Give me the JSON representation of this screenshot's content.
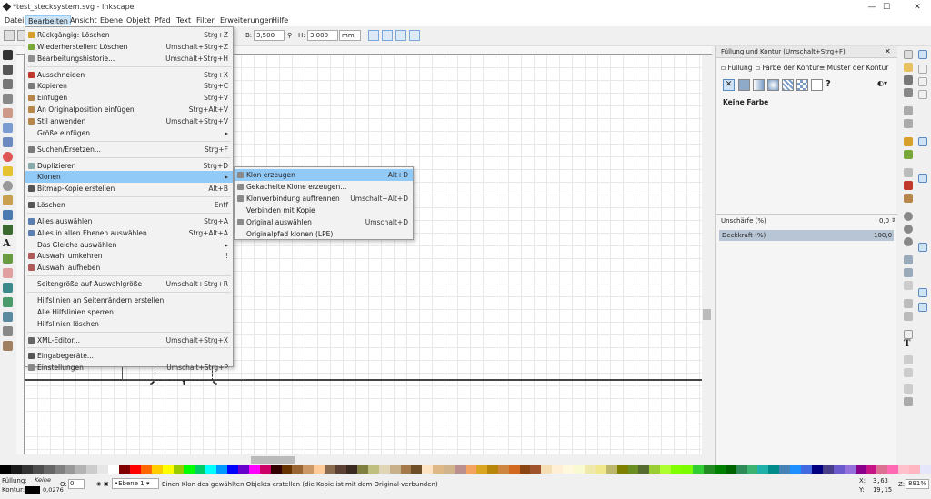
{
  "window": {
    "title": "*test_stecksystem.svg - Inkscape",
    "minimize": "—",
    "maximize": "☐",
    "close": "✕"
  },
  "menubar": [
    "Datei",
    "Bearbeiten",
    "Ansicht",
    "Ebene",
    "Objekt",
    "Pfad",
    "Text",
    "Filter",
    "Erweiterungen",
    "Hilfe"
  ],
  "toolbar": {
    "b_label": "B:",
    "b_value": "3,500",
    "h_label": "H:",
    "h_value": "3,000",
    "unit": "mm"
  },
  "edit_menu": [
    {
      "label": "Rückgängig: Löschen",
      "acc": "Strg+Z",
      "icon": "undo-icon",
      "color": "#d6a02a"
    },
    {
      "label": "Wiederherstellen: Löschen",
      "acc": "Umschalt+Strg+Z",
      "icon": "redo-icon",
      "color": "#7aa83a"
    },
    {
      "label": "Bearbeitungshistorie...",
      "acc": "Umschalt+Strg+H",
      "icon": "history-icon",
      "color": "#8e8e8e"
    },
    {
      "sep": true
    },
    {
      "label": "Ausschneiden",
      "acc": "Strg+X",
      "icon": "cut-icon",
      "color": "#c0392b"
    },
    {
      "label": "Kopieren",
      "acc": "Strg+C",
      "icon": "copy-icon",
      "color": "#7a7a7a"
    },
    {
      "label": "Einfügen",
      "acc": "Strg+V",
      "icon": "paste-icon",
      "color": "#b9864a"
    },
    {
      "label": "An Originalposition einfügen",
      "acc": "Strg+Alt+V",
      "icon": "paste-in-place-icon",
      "color": "#b9864a"
    },
    {
      "label": "Stil anwenden",
      "acc": "Umschalt+Strg+V",
      "icon": "paste-style-icon",
      "color": "#b9864a"
    },
    {
      "label": "Größe einfügen",
      "acc": "▸",
      "icon": "",
      "color": ""
    },
    {
      "sep": true
    },
    {
      "label": "Suchen/Ersetzen...",
      "acc": "Strg+F",
      "icon": "search-icon",
      "color": "#7a7a7a"
    },
    {
      "sep": true
    },
    {
      "label": "Duplizieren",
      "acc": "Strg+D",
      "icon": "duplicate-icon",
      "color": "#8aa"
    },
    {
      "label": "Klonen",
      "acc": "▸",
      "icon": "",
      "color": "",
      "highlight": true
    },
    {
      "label": "Bitmap-Kopie erstellen",
      "acc": "Alt+B",
      "icon": "bitmap-icon",
      "color": "#555"
    },
    {
      "sep": true
    },
    {
      "label": "Löschen",
      "acc": "Entf",
      "icon": "delete-icon",
      "color": "#555"
    },
    {
      "sep": true
    },
    {
      "label": "Alles auswählen",
      "acc": "Strg+A",
      "icon": "select-all-icon",
      "color": "#5a7fb0"
    },
    {
      "label": "Alles in allen Ebenen auswählen",
      "acc": "Strg+Alt+A",
      "icon": "select-all-layers-icon",
      "color": "#5a7fb0"
    },
    {
      "label": "Das Gleiche auswählen",
      "acc": "▸",
      "icon": "",
      "color": ""
    },
    {
      "label": "Auswahl umkehren",
      "acc": "!",
      "icon": "invert-icon",
      "color": "#b05a5a"
    },
    {
      "label": "Auswahl aufheben",
      "acc": "",
      "icon": "deselect-icon",
      "color": "#b05a5a"
    },
    {
      "sep": true
    },
    {
      "label": "Seitengröße auf Auswahlgröße",
      "acc": "Umschalt+Strg+R",
      "icon": "",
      "color": ""
    },
    {
      "sep": true
    },
    {
      "label": "Hilfslinien an Seitenrändern erstellen",
      "acc": "",
      "icon": "",
      "color": ""
    },
    {
      "label": "Alle Hilfslinien sperren",
      "acc": "",
      "icon": "",
      "color": ""
    },
    {
      "label": "Hilfslinien löschen",
      "acc": "",
      "icon": "",
      "color": ""
    },
    {
      "sep": true
    },
    {
      "label": "XML-Editor...",
      "acc": "Umschalt+Strg+X",
      "icon": "xml-icon",
      "color": "#666"
    },
    {
      "sep": true
    },
    {
      "label": "Eingabegeräte...",
      "acc": "",
      "icon": "input-devices-icon",
      "color": "#555"
    },
    {
      "label": "Einstellungen",
      "acc": "Umschalt+Strg+P",
      "icon": "preferences-icon",
      "color": "#888"
    }
  ],
  "clone_submenu": [
    {
      "label": "Klon erzeugen",
      "acc": "Alt+D",
      "highlight": true,
      "icon": "clone-icon"
    },
    {
      "label": "Gekachelte Klone erzeugen...",
      "acc": "",
      "icon": "tiled-clones-icon"
    },
    {
      "label": "Klonverbindung auftrennen",
      "acc": "Umschalt+Alt+D",
      "icon": "unlink-clone-icon"
    },
    {
      "label": "Verbinden mit Kopie",
      "acc": "",
      "icon": ""
    },
    {
      "label": "Original auswählen",
      "acc": "Umschalt+D",
      "icon": "select-original-icon"
    },
    {
      "label": "Originalpfad klonen (LPE)",
      "acc": "",
      "icon": ""
    }
  ],
  "panel": {
    "title": "Füllung und Kontur (Umschalt+Strg+F)",
    "tabs": [
      "Füllung",
      "Farbe der Kontur",
      "Muster der Kontur"
    ],
    "fill_state": "Keine Farbe",
    "blur_label": "Unschärfe (%)",
    "blur_value": "0,0",
    "opacity_label": "Deckkraft (%)",
    "opacity_value": "100,0"
  },
  "status": {
    "fill_label": "Füllung:",
    "fill_value": "Keine",
    "stroke_label": "Kontur:",
    "stroke_width": "0,0276",
    "o_label": "O:",
    "o_value": "0",
    "layer": "•Ebene 1",
    "message": "Einen Klon des gewählten Objekts erstellen (die Kopie ist mit dem Original verbunden)",
    "x_label": "X:",
    "x_value": "3,63",
    "y_label": "Y:",
    "y_value": "19,15",
    "z_label": "Z:",
    "zoom": "891%"
  },
  "palette": [
    "#000000",
    "#1a1a1a",
    "#333",
    "#4d4d4d",
    "#666",
    "#808080",
    "#999",
    "#b3b3b3",
    "#ccc",
    "#e6e6e6",
    "#fff",
    "#800000",
    "#ff0000",
    "#ff6600",
    "#ffcc00",
    "#ffff00",
    "#99cc00",
    "#00ff00",
    "#00cc66",
    "#00ffff",
    "#0099ff",
    "#0000ff",
    "#6600cc",
    "#ff00ff",
    "#cc0066",
    "#330000",
    "#663300",
    "#996633",
    "#cc9966",
    "#ffcc99",
    "#8a6b4e",
    "#5c4033",
    "#3b2a1f",
    "#7f7f3f",
    "#bfbf7f",
    "#e0d5b5",
    "#c8b08a",
    "#a57a4b",
    "#6f4f28",
    "#ffe4c4",
    "#deb887",
    "#d2b48c",
    "#bc8f8f",
    "#f4a460",
    "#daa520",
    "#b8860b",
    "#cd853f",
    "#d2691e",
    "#8b4513",
    "#a0522d",
    "#f5deb3",
    "#ffefd5",
    "#fff8dc",
    "#fafad2",
    "#eee8aa",
    "#f0e68c",
    "#bdb76b",
    "#808000",
    "#6b8e23",
    "#556b2f",
    "#9acd32",
    "#adff2f",
    "#7fff00",
    "#7cfc00",
    "#32cd32",
    "#228b22",
    "#008000",
    "#006400",
    "#2e8b57",
    "#3cb371",
    "#20b2aa",
    "#008b8b",
    "#4682b4",
    "#1e90ff",
    "#4169e1",
    "#000080",
    "#483d8b",
    "#6a5acd",
    "#9370db",
    "#8b008b",
    "#c71585",
    "#db7093",
    "#ff69b4",
    "#ffc0cb",
    "#ffb6c1",
    "#e6e6fa"
  ]
}
